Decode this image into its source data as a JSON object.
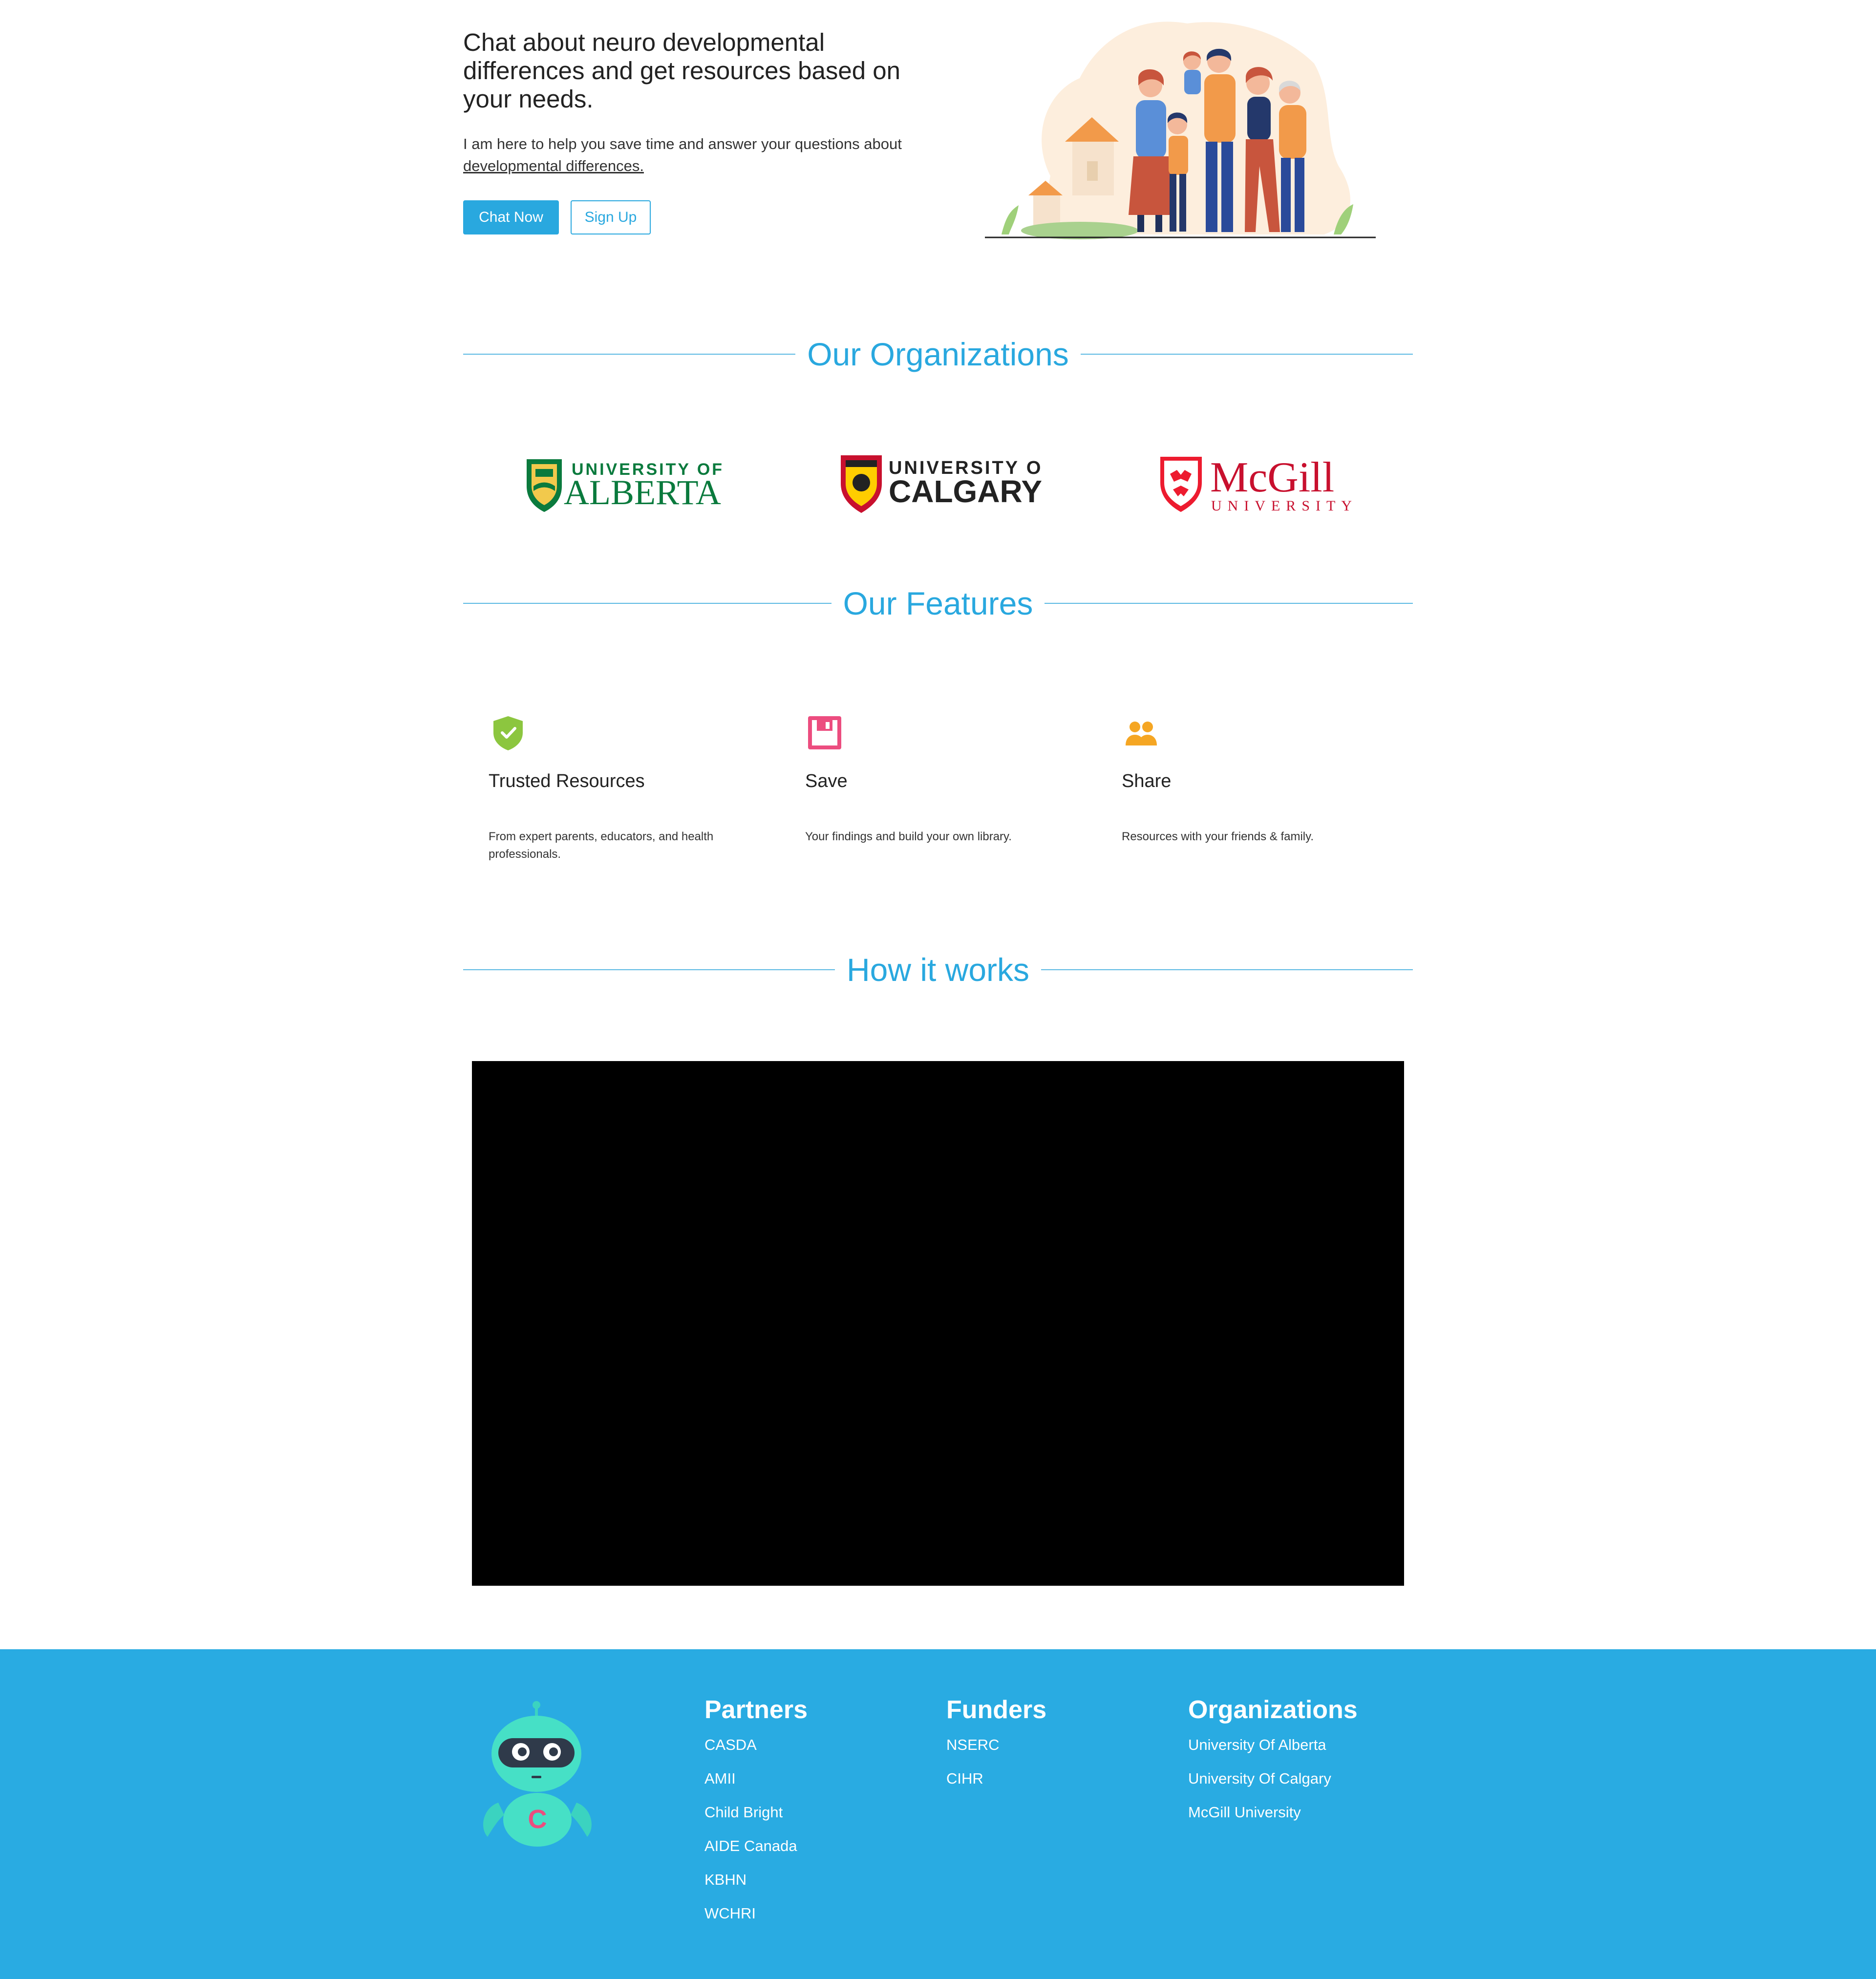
{
  "hero": {
    "title": "Chat about neuro developmental differences and get resources based on your needs.",
    "subtitle_prefix": "I am here to help you save time and answer your questions about ",
    "subtitle_link": "developmental differences.",
    "chat_button": "Chat Now",
    "signup_button": "Sign Up"
  },
  "organizations": {
    "heading": "Our Organizations",
    "alberta_top": "UNIVERSITY OF",
    "alberta_main": "ALBERTA",
    "calgary_top": "UNIVERSITY OF",
    "calgary_main": "CALGARY",
    "mcgill_main": "McGill",
    "mcgill_sub": "UNIVERSITY"
  },
  "features": {
    "heading": "Our Features",
    "items": [
      {
        "name": "Trusted Resources",
        "desc": "From expert parents, educators, and health professionals.",
        "icon": "shield-check-icon",
        "color": "#8cc63f"
      },
      {
        "name": "Save",
        "desc": "Your findings and build your own library.",
        "icon": "floppy-disk-icon",
        "color": "#ec4d7f"
      },
      {
        "name": "Share",
        "desc": "Resources with your friends & family.",
        "icon": "people-icon",
        "color": "#f5a623"
      }
    ]
  },
  "how": {
    "heading": "How it works"
  },
  "footer": {
    "bg_color": "#29abe2",
    "partners": {
      "heading": "Partners",
      "items": [
        "CASDA",
        "AMII",
        "Child Bright",
        "AIDE Canada",
        "KBHN",
        "WCHRI"
      ]
    },
    "funders": {
      "heading": "Funders",
      "items": [
        "NSERC",
        "CIHR"
      ]
    },
    "organizations": {
      "heading": "Organizations",
      "items": [
        "University Of Alberta",
        "University Of Calgary",
        "McGill University"
      ]
    }
  }
}
